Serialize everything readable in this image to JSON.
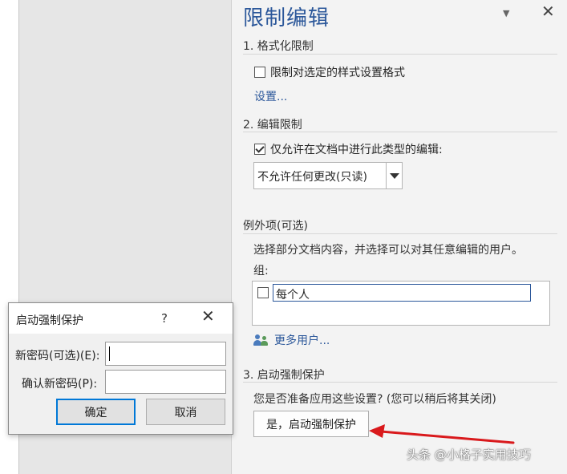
{
  "pane": {
    "title": "限制编辑",
    "pin_glyph": "▼",
    "close_glyph": "✕"
  },
  "section1": {
    "heading": "1. 格式化限制",
    "checkbox_label": "限制对选定的样式设置格式",
    "checkbox_checked": false,
    "settings_link": "设置..."
  },
  "section2": {
    "heading": "2. 编辑限制",
    "checkbox_label": "仅允许在文档中进行此类型的编辑:",
    "checkbox_checked": true,
    "edit_type_selected": "不允许任何更改(只读)",
    "exceptions_heading": "例外项(可选)",
    "exceptions_desc": "选择部分文档内容，并选择可以对其任意编辑的用户。",
    "groups_label": "组:",
    "groups": [
      {
        "name": "每个人",
        "checked": false
      }
    ],
    "more_users_link": "更多用户..."
  },
  "section3": {
    "heading": "3. 启动强制保护",
    "question": "您是否准备应用这些设置? (您可以稍后将其关闭)",
    "enforce_button": "是，启动强制保护"
  },
  "dialog": {
    "title": "启动强制保护",
    "help_glyph": "?",
    "close_glyph": "✕",
    "new_password_label": "新密码(可选)(E):",
    "new_password_value": "",
    "confirm_password_label": "确认新密码(P):",
    "confirm_password_value": "",
    "ok_button": "确定",
    "cancel_button": "取消"
  },
  "annotation": {
    "arrow_color": "#d9191c"
  },
  "watermark": "头条 @小格子实用技巧"
}
